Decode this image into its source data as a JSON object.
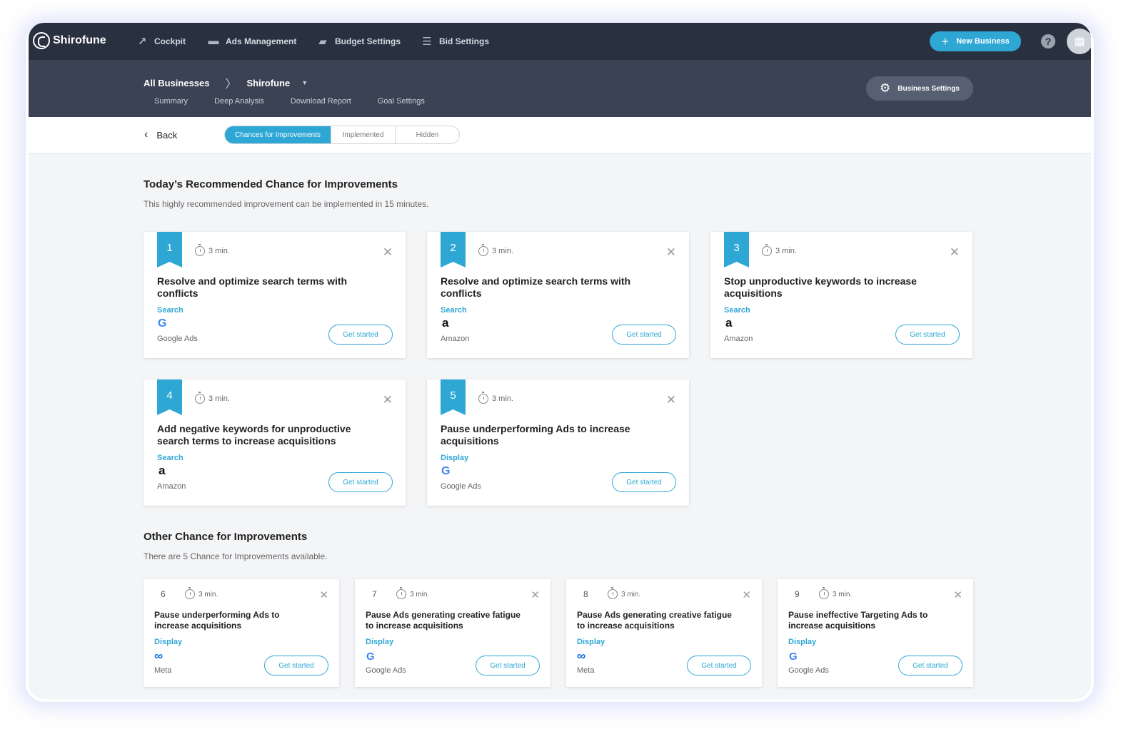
{
  "app": {
    "logo": "Shirofune"
  },
  "nav": [
    {
      "label": "Cockpit",
      "icon": "trend-icon"
    },
    {
      "label": "Ads Management",
      "icon": "folder-icon"
    },
    {
      "label": "Budget Settings",
      "icon": "wallet-icon"
    },
    {
      "label": "Bid Settings",
      "icon": "sliders-icon"
    }
  ],
  "header_actions": {
    "new_business": "New Business",
    "help": "?"
  },
  "breadcrumb": {
    "root": "All Businesses",
    "current": "Shirofune"
  },
  "subtabs": [
    "Summary",
    "Deep Analysis",
    "Download Report",
    "Goal Settings"
  ],
  "business_settings": "Business Settings",
  "toolbar": {
    "back": "Back",
    "tabs": [
      "Chances for Improvements",
      "Implemented",
      "Hidden"
    ],
    "active_tab": 0
  },
  "recommended": {
    "title": "Today’s Recommended Chance for Improvements",
    "subtitle": "This highly recommended improvement can be implemented in 15 minutes.",
    "cards": [
      {
        "num": "1",
        "time": "3 min.",
        "title_lines": [
          "Resolve and optimize search terms with",
          "conflicts"
        ],
        "type": "Search",
        "platform": "Google Ads",
        "platform_icon": "google-icon",
        "cta": "Get started"
      },
      {
        "num": "2",
        "time": "3 min.",
        "title_lines": [
          "Resolve and optimize search terms with",
          "conflicts"
        ],
        "type": "Search",
        "platform": "Amazon",
        "platform_icon": "amazon-icon",
        "cta": "Get started"
      },
      {
        "num": "3",
        "time": "3 min.",
        "title_lines": [
          "Stop unproductive keywords to increase",
          "acquisitions"
        ],
        "type": "Search",
        "platform": "Amazon",
        "platform_icon": "amazon-icon",
        "cta": "Get started"
      },
      {
        "num": "4",
        "time": "3 min.",
        "title_lines": [
          "Add negative keywords for unproductive",
          "search terms to increase acquisitions"
        ],
        "type": "Search",
        "platform": "Amazon",
        "platform_icon": "amazon-icon",
        "cta": "Get started"
      },
      {
        "num": "5",
        "time": "3 min.",
        "title_lines": [
          "Pause underperforming Ads to increase",
          "acquisitions"
        ],
        "type": "Display",
        "platform": "Google Ads",
        "platform_icon": "google-icon",
        "cta": "Get started"
      }
    ]
  },
  "other": {
    "title": "Other Chance for Improvements",
    "subtitle": "There are 5 Chance for Improvements available.",
    "cards": [
      {
        "num": "6",
        "time": "3 min.",
        "title_lines": [
          "Pause underperforming Ads to",
          "increase acquisitions"
        ],
        "type": "Display",
        "platform": "Meta",
        "platform_icon": "meta-icon",
        "cta": "Get started"
      },
      {
        "num": "7",
        "time": "3 min.",
        "title_lines": [
          "Pause Ads generating creative fatigue",
          "to increase acquisitions"
        ],
        "type": "Display",
        "platform": "Google Ads",
        "platform_icon": "google-icon",
        "cta": "Get started"
      },
      {
        "num": "8",
        "time": "3 min.",
        "title_lines": [
          "Pause Ads generating creative fatigue",
          "to increase acquisitions"
        ],
        "type": "Display",
        "platform": "Meta",
        "platform_icon": "meta-icon",
        "cta": "Get started"
      },
      {
        "num": "9",
        "time": "3 min.",
        "title_lines": [
          "Pause ineffective Targeting Ads to",
          "increase acquisitions"
        ],
        "type": "Display",
        "platform": "Google Ads",
        "platform_icon": "google-icon",
        "cta": "Get started"
      }
    ]
  },
  "colors": {
    "accent": "#2fa7d5",
    "topbar": "#293140",
    "subheader": "#3a4253"
  }
}
